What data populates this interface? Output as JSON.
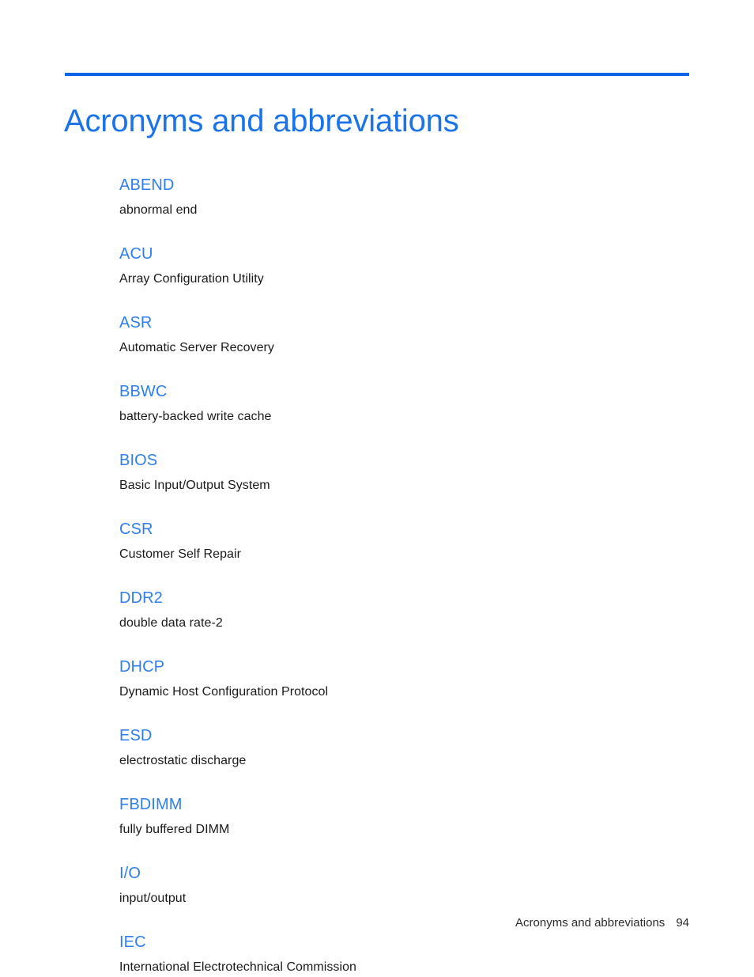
{
  "document": {
    "chapter_title": "Acronyms and abbreviations",
    "accent_color": "#1a73e8",
    "rule_color": "#0b63e5",
    "term_color": "#2d7ff0",
    "body_color": "#1a1a1a"
  },
  "glossary": {
    "entries": [
      {
        "term": "ABEND",
        "definition": "abnormal end"
      },
      {
        "term": "ACU",
        "definition": "Array Configuration Utility"
      },
      {
        "term": "ASR",
        "definition": "Automatic Server Recovery"
      },
      {
        "term": "BBWC",
        "definition": "battery-backed write cache"
      },
      {
        "term": "BIOS",
        "definition": "Basic Input/Output System"
      },
      {
        "term": "CSR",
        "definition": "Customer Self Repair"
      },
      {
        "term": "DDR2",
        "definition": "double data rate-2"
      },
      {
        "term": "DHCP",
        "definition": "Dynamic Host Configuration Protocol"
      },
      {
        "term": "ESD",
        "definition": "electrostatic discharge"
      },
      {
        "term": "FBDIMM",
        "definition": "fully buffered DIMM"
      },
      {
        "term": "I/O",
        "definition": "input/output"
      },
      {
        "term": "IEC",
        "definition": "International Electrotechnical Commission"
      }
    ]
  },
  "footer": {
    "label": "Acronyms and abbreviations",
    "page_number": "94"
  }
}
